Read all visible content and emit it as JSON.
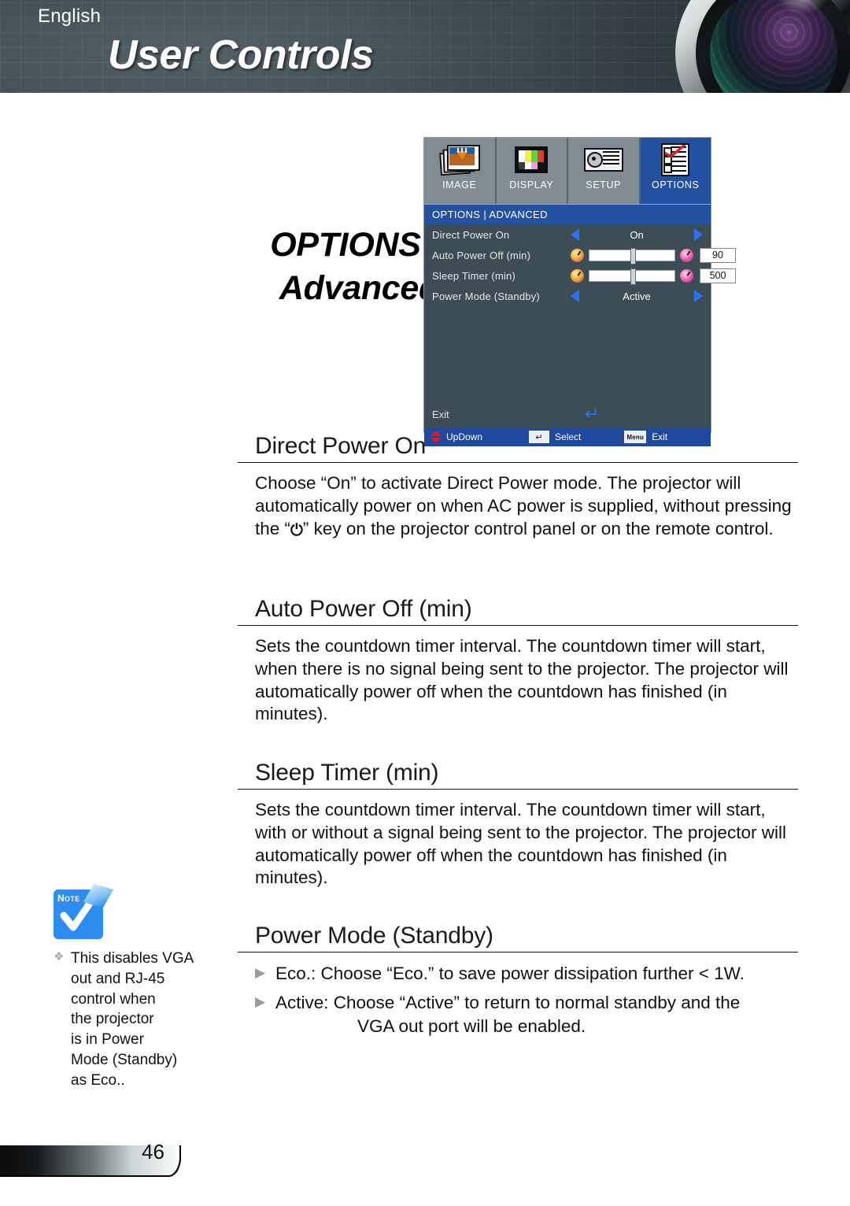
{
  "header": {
    "title": "User Controls",
    "lens_icon": "camera-lens-graphic"
  },
  "section": {
    "line1": "OPTIONS |",
    "line2": "Advanced"
  },
  "osd": {
    "tabs": [
      {
        "label": "IMAGE",
        "icon": "image-photos-icon",
        "active": false
      },
      {
        "label": "DISPLAY",
        "icon": "color-bars-icon",
        "active": false
      },
      {
        "label": "SETUP",
        "icon": "projector-icon",
        "active": false
      },
      {
        "label": "OPTIONS",
        "icon": "checklist-icon",
        "active": true
      }
    ],
    "breadcrumb": "OPTIONS | ADVANCED",
    "rows": [
      {
        "label": "Direct Power On",
        "type": "selector",
        "value": "On",
        "left_icon": "arrow-left-icon",
        "right_icon": "arrow-right-icon"
      },
      {
        "label": "Auto Power Off (min)",
        "type": "slider",
        "value": "90",
        "left_icon": "clock-small-icon",
        "right_icon": "clock-large-icon",
        "thumb_percent": 48
      },
      {
        "label": "Sleep Timer (min)",
        "type": "slider",
        "value": "500",
        "left_icon": "clock-small-icon",
        "right_icon": "clock-large-icon",
        "thumb_percent": 48
      },
      {
        "label": "Power Mode (Standby)",
        "type": "selector",
        "value": "Active",
        "left_icon": "arrow-left-icon",
        "right_icon": "arrow-right-icon"
      }
    ],
    "exit_label": "Exit",
    "exit_enter_glyph": "↵",
    "footer": [
      {
        "key_icon": "up-down-arrows-icon",
        "label": "UpDown"
      },
      {
        "key_icon": "enter-key-icon",
        "key_text": "↵",
        "label": "Select"
      },
      {
        "key_icon": "menu-key-icon",
        "key_text": "Menu",
        "label": "Exit"
      }
    ]
  },
  "topics": [
    {
      "title": "Direct Power On",
      "body_before": "Choose “On” to activate Direct Power mode. The projector will automatically power on when AC power is supplied, without pressing the “",
      "power_glyph": "⏻",
      "body_after": "” key on the projector control panel or on the remote control."
    },
    {
      "title": "Auto Power Off (min)",
      "body": "Sets the countdown timer interval. The countdown timer will start, when there is no signal being sent to the projector. The projector will automatically power off when the countdown has finished (in minutes)."
    },
    {
      "title": "Sleep Timer (min)",
      "body": "Sets the countdown timer interval. The countdown timer will start, with or without a signal being sent to the projector. The projector will automatically power off when the countdown has finished (in minutes)."
    },
    {
      "title": "Power Mode (Standby)",
      "bullets": [
        {
          "mark": "▶",
          "text": "Eco.: Choose “Eco.” to save power dissipation further < 1W."
        },
        {
          "mark": "▶",
          "text": "Active: Choose “Active” to return to normal standby and the",
          "indent_text": "VGA out port will be enabled."
        }
      ]
    }
  ],
  "note": {
    "icon_label_note": "N",
    "icon_label_ote": "OTE",
    "bullet": "❖",
    "lines": [
      "This disables VGA",
      "out and RJ-45",
      "control when",
      "the projector",
      "is in Power",
      "Mode (Standby)",
      "as Eco.."
    ]
  },
  "footer": {
    "language": "English",
    "page": "46"
  },
  "colors": {
    "osd_accent": "#23509f",
    "osd_body": "#3d4d56",
    "osd_tab": "#808c92",
    "osd_footer": "#1f49a0",
    "arrow_blue": "#2f6ff5",
    "note_blue": "#2d8cf0"
  }
}
